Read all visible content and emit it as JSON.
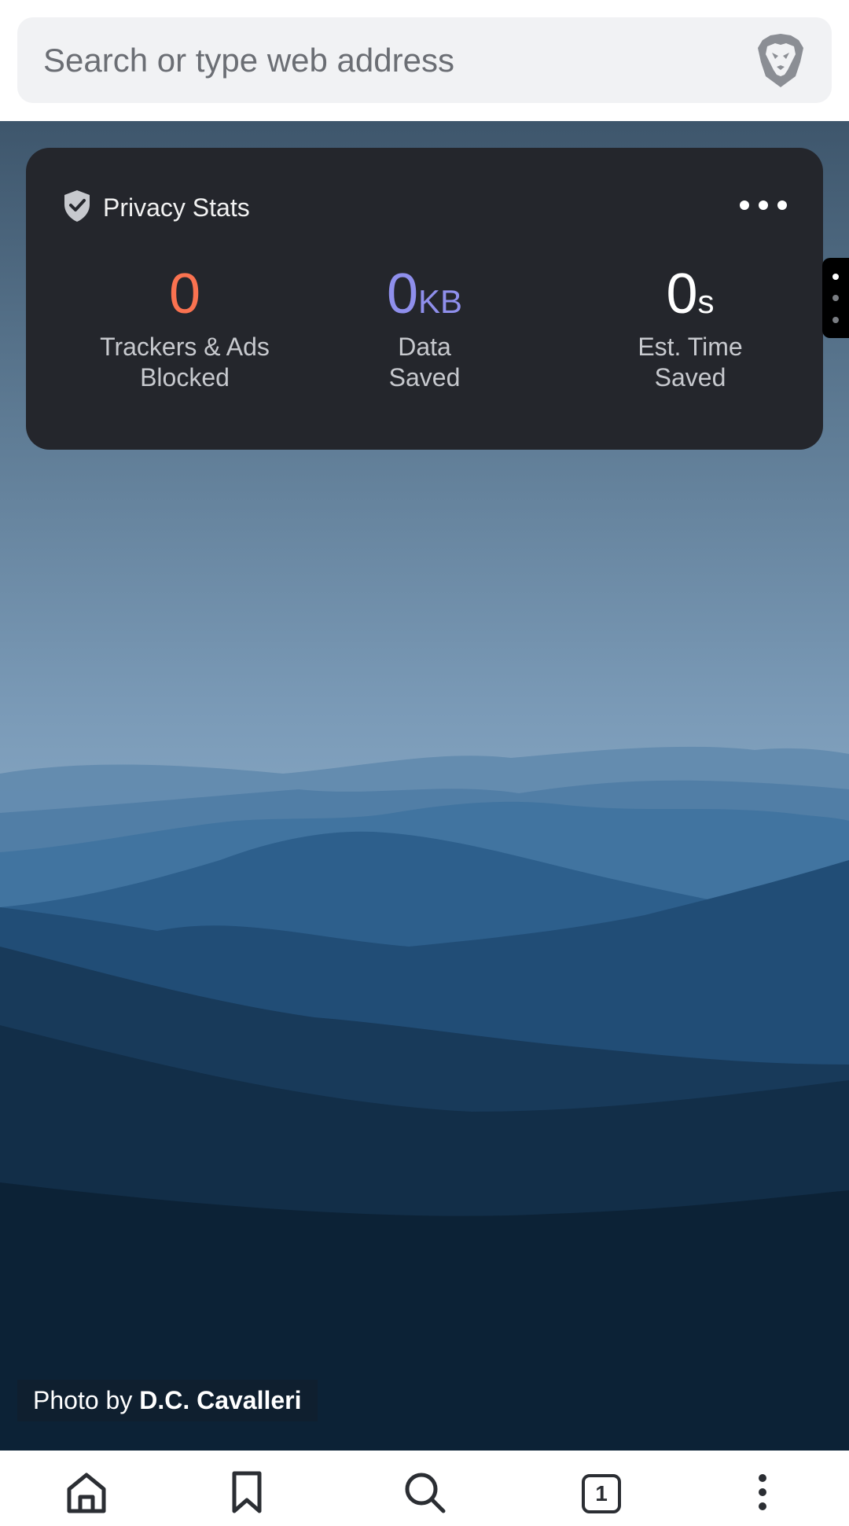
{
  "url_bar": {
    "placeholder": "Search or type web address",
    "shield_icon": "brave-lion-icon"
  },
  "privacy_stats": {
    "title": "Privacy Stats",
    "title_icon": "shield-check-icon",
    "menu_icon": "more-horizontal-icon",
    "stats": [
      {
        "value": "0",
        "unit": "",
        "label_line1": "Trackers & Ads",
        "label_line2": "Blocked",
        "color": "#fa7250"
      },
      {
        "value": "0",
        "unit": "KB",
        "label_line1": "Data",
        "label_line2": "Saved",
        "color": "#8f8fec"
      },
      {
        "value": "0",
        "unit": "s",
        "label_line1": "Est. Time",
        "label_line2": "Saved",
        "color": "#ffffff"
      }
    ]
  },
  "photo_credit": {
    "prefix": "Photo by",
    "author": "D.C. Cavalleri"
  },
  "bottom_toolbar": {
    "items": [
      {
        "name": "home",
        "icon": "home-icon"
      },
      {
        "name": "bookmarks",
        "icon": "bookmark-icon"
      },
      {
        "name": "search",
        "icon": "search-icon"
      },
      {
        "name": "tabs",
        "icon": "tabs-icon",
        "count": "1"
      },
      {
        "name": "menu",
        "icon": "more-vertical-icon"
      }
    ]
  },
  "colors": {
    "card_background": "#24262c",
    "trackers_accent": "#fa7250",
    "data_accent": "#8f8fec"
  }
}
